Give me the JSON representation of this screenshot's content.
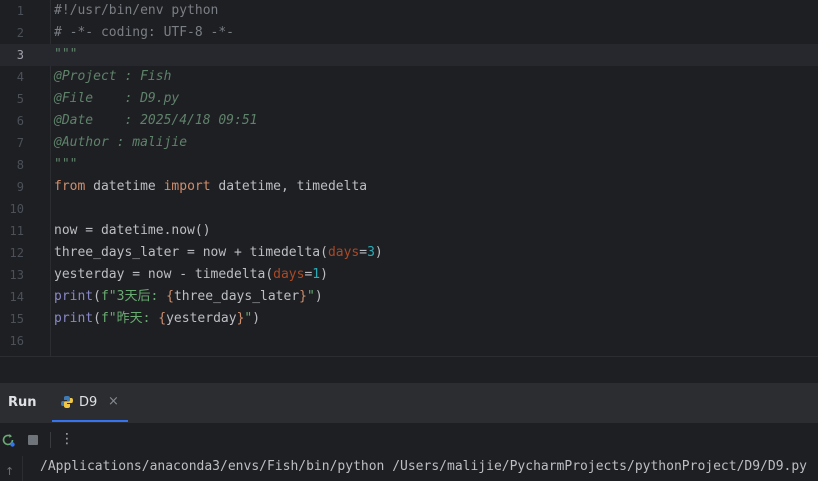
{
  "editor": {
    "current_line": 3,
    "lines": [
      {
        "n": "1",
        "parts": [
          {
            "c": "cm",
            "t": "#!/usr/bin/env python"
          }
        ]
      },
      {
        "n": "2",
        "parts": [
          {
            "c": "cm",
            "t": "# -*- coding: UTF-8 -*-"
          }
        ]
      },
      {
        "n": "3",
        "parts": [
          {
            "c": "doc",
            "t": "\"\"\""
          }
        ]
      },
      {
        "n": "4",
        "parts": [
          {
            "c": "doc",
            "t": "@Project : Fish"
          }
        ]
      },
      {
        "n": "5",
        "parts": [
          {
            "c": "doc",
            "t": "@File    : D9.py"
          }
        ]
      },
      {
        "n": "6",
        "parts": [
          {
            "c": "doc",
            "t": "@Date    : 2025/4/18 09:51"
          }
        ]
      },
      {
        "n": "7",
        "parts": [
          {
            "c": "doc",
            "t": "@Author : malijie"
          }
        ]
      },
      {
        "n": "8",
        "parts": [
          {
            "c": "doc",
            "t": "\"\"\""
          }
        ]
      },
      {
        "n": "9",
        "parts": [
          {
            "c": "kw",
            "t": "from"
          },
          {
            "c": "plain",
            "t": " datetime "
          },
          {
            "c": "kw",
            "t": "import"
          },
          {
            "c": "plain",
            "t": " datetime, timedelta"
          }
        ]
      },
      {
        "n": "10",
        "parts": []
      },
      {
        "n": "11",
        "parts": [
          {
            "c": "plain",
            "t": "now = datetime.now()"
          }
        ]
      },
      {
        "n": "12",
        "parts": [
          {
            "c": "plain",
            "t": "three_days_later = now + timedelta("
          },
          {
            "c": "param",
            "t": "days"
          },
          {
            "c": "plain",
            "t": "="
          },
          {
            "c": "num",
            "t": "3"
          },
          {
            "c": "plain",
            "t": ")"
          }
        ]
      },
      {
        "n": "13",
        "parts": [
          {
            "c": "plain",
            "t": "yesterday = now - timedelta("
          },
          {
            "c": "param",
            "t": "days"
          },
          {
            "c": "plain",
            "t": "="
          },
          {
            "c": "num",
            "t": "1"
          },
          {
            "c": "plain",
            "t": ")"
          }
        ]
      },
      {
        "n": "14",
        "parts": [
          {
            "c": "fn",
            "t": "print"
          },
          {
            "c": "plain",
            "t": "("
          },
          {
            "c": "str",
            "t": "f\"3天后: "
          },
          {
            "c": "kw",
            "t": "{"
          },
          {
            "c": "plain",
            "t": "three_days_later"
          },
          {
            "c": "kw",
            "t": "}"
          },
          {
            "c": "str",
            "t": "\""
          },
          {
            "c": "plain",
            "t": ")"
          }
        ]
      },
      {
        "n": "15",
        "parts": [
          {
            "c": "fn",
            "t": "print"
          },
          {
            "c": "plain",
            "t": "("
          },
          {
            "c": "str",
            "t": "f\"昨天: "
          },
          {
            "c": "kw",
            "t": "{"
          },
          {
            "c": "plain",
            "t": "yesterday"
          },
          {
            "c": "kw",
            "t": "}"
          },
          {
            "c": "str",
            "t": "\""
          },
          {
            "c": "plain",
            "t": ")"
          }
        ]
      },
      {
        "n": "16",
        "parts": []
      }
    ]
  },
  "run_panel": {
    "label": "Run",
    "tab_label": "D9",
    "tab_close": "×",
    "more": "⋮",
    "up": "↑",
    "console_line": "/Applications/anaconda3/envs/Fish/bin/python /Users/malijie/PycharmProjects/pythonProject/D9/D9.py"
  },
  "colors": {
    "background": "#1e1f22",
    "panel": "#2b2d30",
    "accent": "#3574f0",
    "keyword": "#cf8e6d",
    "string": "#6aab73",
    "number": "#2aacb8",
    "docstring": "#5f826b"
  },
  "icons": {
    "rerun": "rerun-icon",
    "stop": "stop-icon",
    "python": "python-icon"
  }
}
